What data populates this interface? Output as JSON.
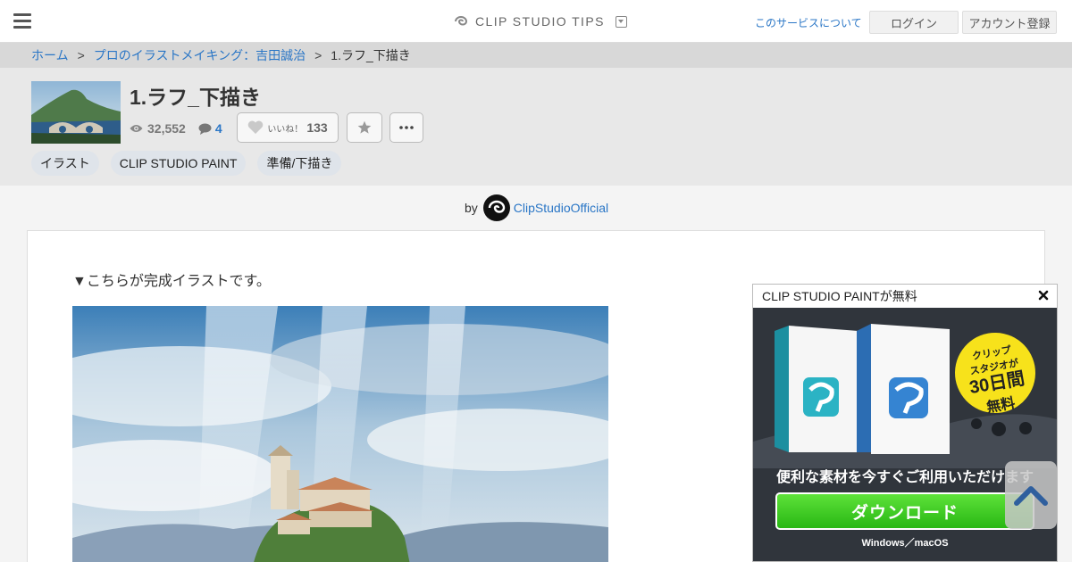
{
  "header": {
    "brand": "CLIP STUDIO TIPS",
    "about_link": "このサービスについて",
    "login": "ログイン",
    "register": "アカウント登録"
  },
  "breadcrumb": {
    "home": "ホーム",
    "series": "プロのイラストメイキング：吉田誠治",
    "current": "1.ラフ_下描き",
    "separator": ">"
  },
  "article": {
    "title": "1.ラフ_下描き",
    "views": "32,552",
    "comments": "4",
    "like_label": "いいね！",
    "like_count": "133",
    "tags": [
      "イラスト",
      "CLIP STUDIO PAINT",
      "準備/下描き"
    ]
  },
  "author": {
    "by": "by",
    "name": "ClipStudioOfficial"
  },
  "content": {
    "intro": "▼こちらが完成イラストです。"
  },
  "ad": {
    "title": "CLIP STUDIO PAINTが無料",
    "badge_line1": "クリップ",
    "badge_line2": "スタジオが",
    "badge_line3": "30日間",
    "badge_line4": "無料",
    "tagline": "便利な素材を今すぐご利用いただけます",
    "download": "ダウンロード",
    "os": "Windows／macOS"
  },
  "colors": {
    "link": "#2a76c6",
    "download_green": "#28b714",
    "badge_yellow": "#f7e21b"
  }
}
